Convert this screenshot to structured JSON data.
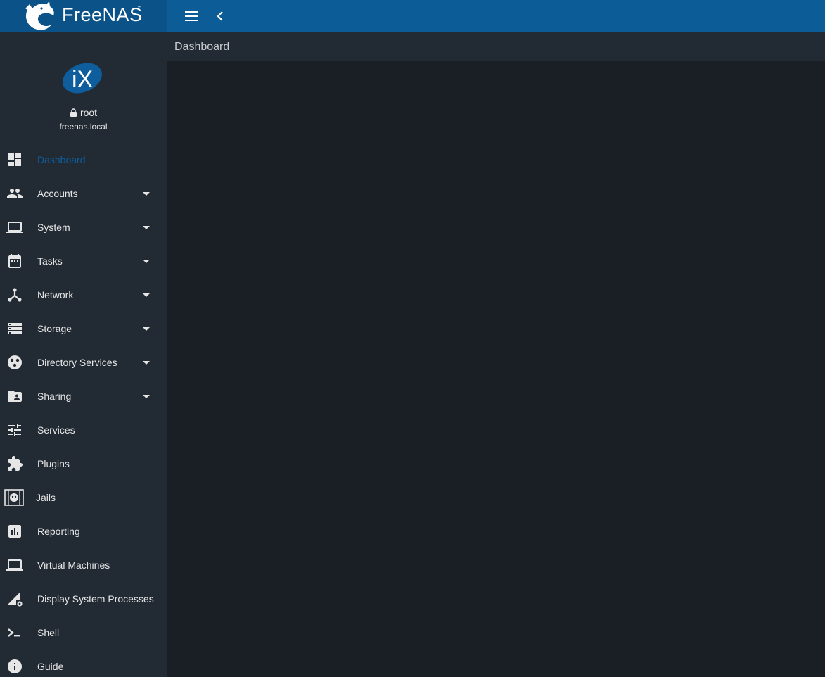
{
  "app": {
    "brand_name": "FreeNAS",
    "brand_tm": "™"
  },
  "colors": {
    "topbar": "#0c5c97",
    "sidebar": "#222a33",
    "content": "#1a1f26",
    "active_accent": "#0e5d9c"
  },
  "header": {
    "menu_icon": "hamburger-icon",
    "collapse_icon": "chevron-left-icon"
  },
  "profile": {
    "logo_text": "iX",
    "username": "root",
    "hostname": "freenas.local"
  },
  "sidebar": {
    "items": [
      {
        "label": "Dashboard",
        "icon": "dashboard-icon",
        "active": true,
        "has_caret": false
      },
      {
        "label": "Accounts",
        "icon": "people-icon",
        "has_caret": true
      },
      {
        "label": "System",
        "icon": "laptop-icon",
        "has_caret": true
      },
      {
        "label": "Tasks",
        "icon": "calendar-icon",
        "has_caret": true
      },
      {
        "label": "Network",
        "icon": "network-icon",
        "has_caret": true
      },
      {
        "label": "Storage",
        "icon": "storage-icon",
        "has_caret": true
      },
      {
        "label": "Directory Services",
        "icon": "directory-icon",
        "has_caret": true
      },
      {
        "label": "Sharing",
        "icon": "shared-folder-icon",
        "has_caret": true
      },
      {
        "label": "Services",
        "icon": "tune-icon",
        "has_caret": false
      },
      {
        "label": "Plugins",
        "icon": "puzzle-icon",
        "has_caret": false
      },
      {
        "label": "Jails",
        "icon": "jail-icon",
        "has_caret": false
      },
      {
        "label": "Reporting",
        "icon": "bar-chart-icon",
        "has_caret": false
      },
      {
        "label": "Virtual Machines",
        "icon": "laptop-icon",
        "has_caret": false
      },
      {
        "label": "Display System Processes",
        "icon": "signal-settings-icon",
        "has_caret": false
      },
      {
        "label": "Shell",
        "icon": "terminal-icon",
        "has_caret": false
      },
      {
        "label": "Guide",
        "icon": "info-icon",
        "has_caret": false
      }
    ]
  },
  "content": {
    "page_title": "Dashboard"
  }
}
